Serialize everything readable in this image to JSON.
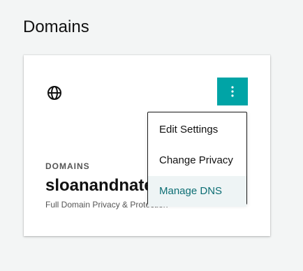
{
  "page": {
    "title": "Domains"
  },
  "card": {
    "icon": "globe-icon",
    "more_icon": "kebab-vertical-icon",
    "label": "DOMAINS",
    "domain_name": "sloanandnate",
    "privacy": "Full Domain Privacy & Protection"
  },
  "menu": {
    "items": [
      {
        "label": "Edit Settings"
      },
      {
        "label": "Change Privacy"
      },
      {
        "label": "Manage DNS"
      }
    ]
  },
  "colors": {
    "accent": "#00a4a6",
    "active_text": "#0d6e74",
    "active_bg": "#eef4f5",
    "background": "#f3f5f5"
  }
}
